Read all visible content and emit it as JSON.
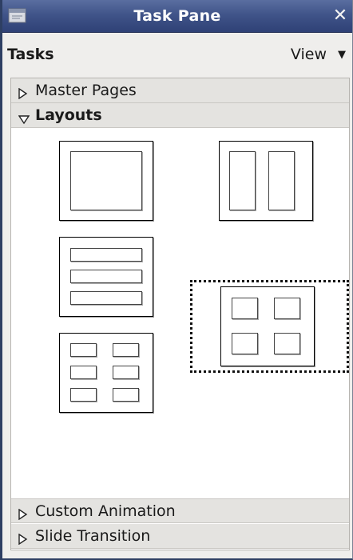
{
  "window": {
    "title": "Task Pane",
    "close_label": "✕",
    "icon": "app-icon"
  },
  "header": {
    "tasks_label": "Tasks",
    "view_label": "View",
    "view_caret": "▼"
  },
  "sections": {
    "master_pages": {
      "label": "Master Pages",
      "state": "collapsed"
    },
    "layouts": {
      "label": "Layouts",
      "state": "expanded"
    },
    "custom_animation": {
      "label": "Custom Animation",
      "state": "collapsed"
    },
    "slide_transition": {
      "label": "Slide Transition",
      "state": "collapsed"
    }
  },
  "layouts": [
    {
      "name": "title-content",
      "selected": false
    },
    {
      "name": "two-columns",
      "selected": false
    },
    {
      "name": "three-rows",
      "selected": false
    },
    {
      "name": "four-objects",
      "selected": true
    },
    {
      "name": "six-objects",
      "selected": false
    }
  ],
  "colors": {
    "titlebar": "#3f5388",
    "section_header": "#e4e3e0",
    "panel_bg": "#ffffff"
  }
}
